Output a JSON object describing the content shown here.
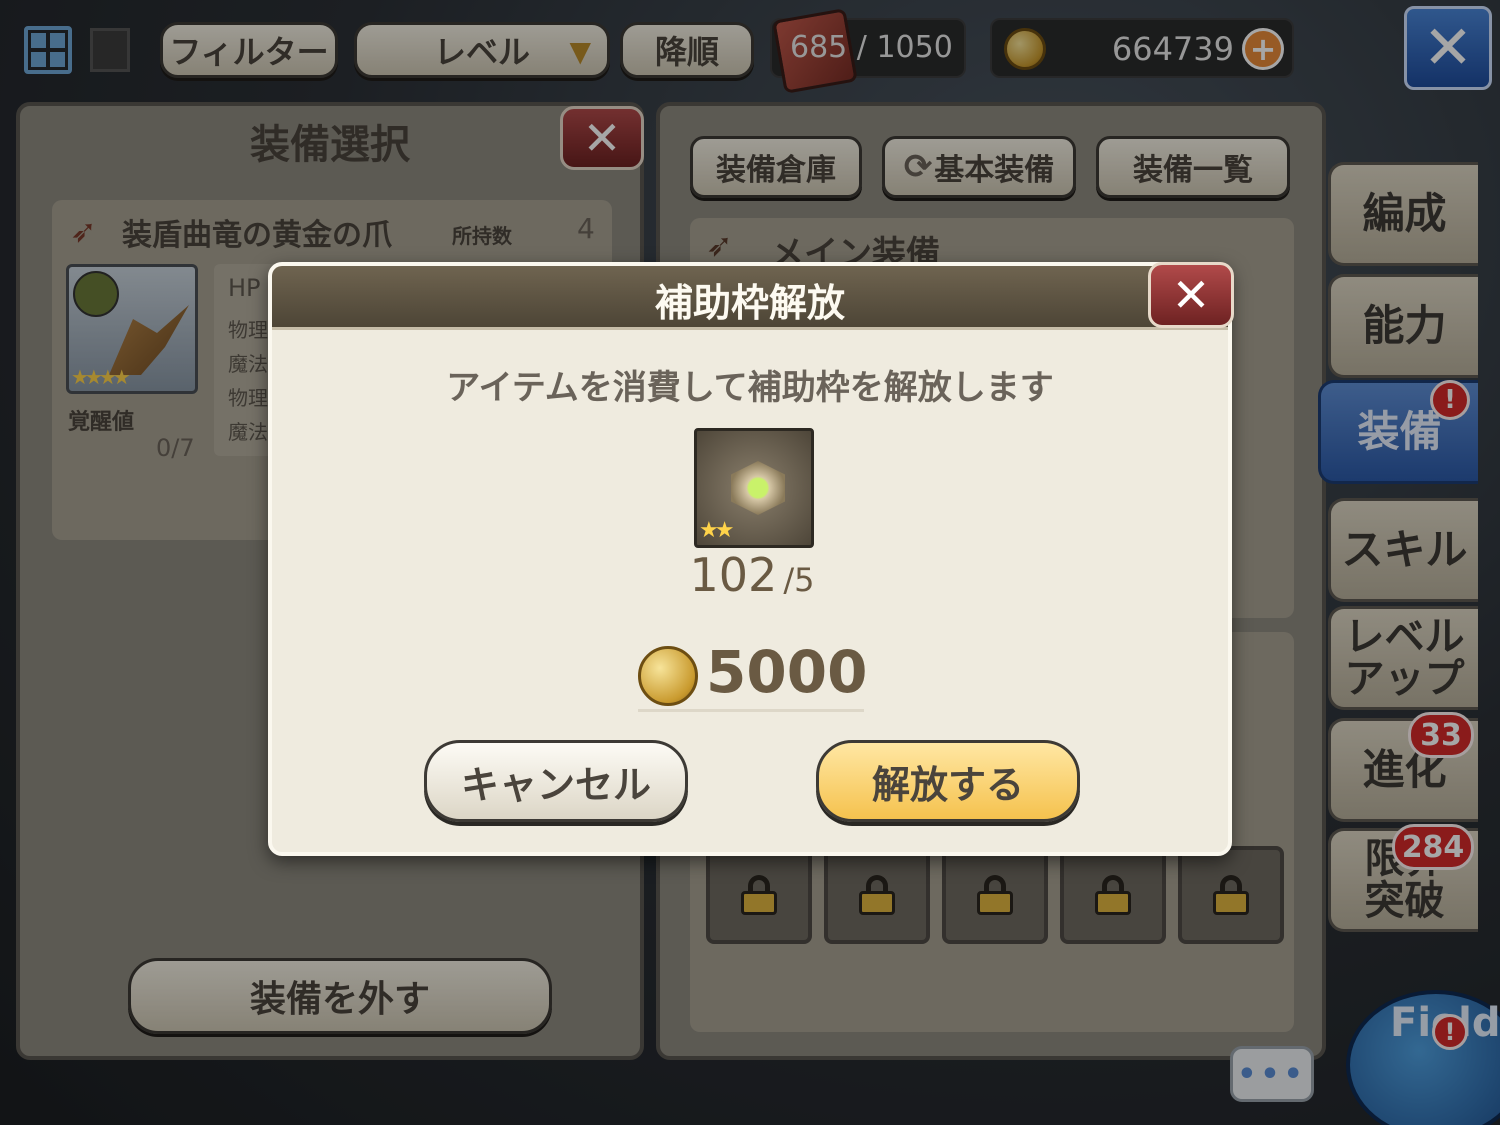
{
  "topbar": {
    "filter_label": "フィルター",
    "sort_key_label": "レベル",
    "order_label": "降順",
    "capacity_current": "685",
    "capacity_sep": " / ",
    "capacity_max": "1050",
    "gold": "664739"
  },
  "left_panel": {
    "title": "装備選択",
    "item_name": "装盾曲竜の黄金の爪",
    "owned_label": "所持数",
    "owned_count": "4",
    "awaken_label": "覚醒値",
    "awaken_value": "0/7",
    "stat_labels": [
      "HP",
      "物理",
      "魔法",
      "物理",
      "魔法"
    ],
    "unequip_label": "装備を外す"
  },
  "right_panel": {
    "tabs": [
      "装備倉庫",
      "基本装備",
      "装備一覧"
    ],
    "section_label": "メイン装備"
  },
  "side_tabs": [
    {
      "label": "編成"
    },
    {
      "label": "能力"
    },
    {
      "label": "装備",
      "badge": "!"
    },
    {
      "label": "スキル"
    },
    {
      "label": "レベル\nアップ"
    },
    {
      "label": "進化",
      "badge": "33"
    },
    {
      "label": "限界\n突破",
      "badge": "284"
    }
  ],
  "dialog": {
    "title": "補助枠解放",
    "message": "アイテムを消費して補助枠を解放します",
    "item_have": "102",
    "item_need": "/5",
    "cost": "5000",
    "cancel_label": "キャンセル",
    "confirm_label": "解放する"
  },
  "field_label": "Field",
  "colors": {
    "confirm": "#f5c24e",
    "active_tab": "#2c5aa8",
    "badge": "#d52a2a"
  }
}
